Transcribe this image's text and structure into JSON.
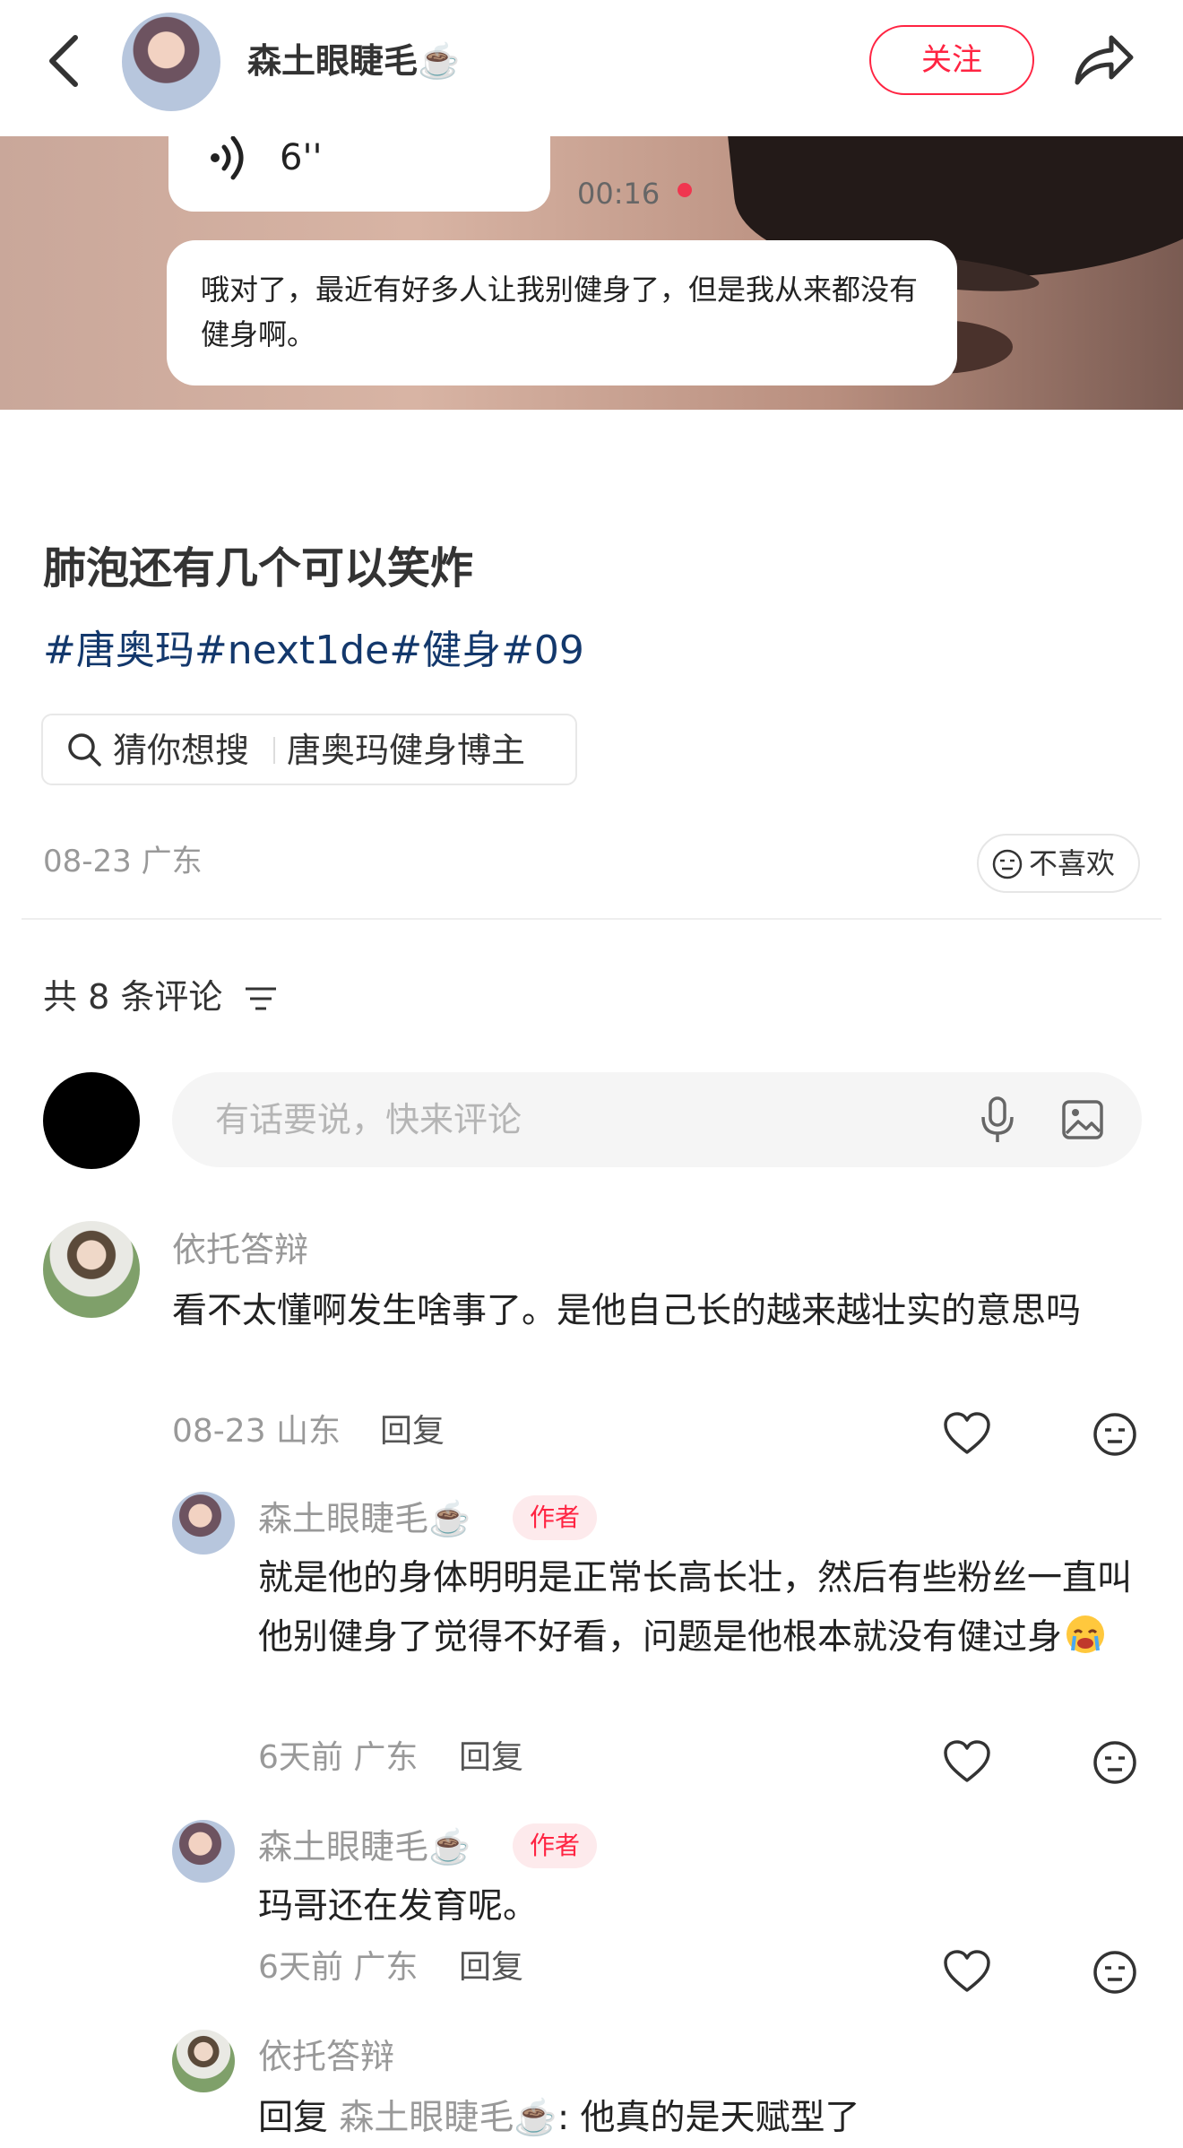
{
  "header": {
    "author_name": "森土眼睫毛☕️",
    "follow_label": "关注"
  },
  "hero": {
    "voice_duration": "6''",
    "time_stamp": "00:16",
    "bubble_text": "哦对了，最近有好多人让我别健身了，但是我从来都没有健身啊。"
  },
  "post": {
    "title": "肺泡还有几个可以笑炸",
    "tags": "#唐奥玛#next1de#健身#09",
    "search_chip_label": "猜你想搜",
    "search_chip_term": "唐奥玛健身博主",
    "meta": "08-23 广东",
    "dislike_label": "不喜欢"
  },
  "comments": {
    "count_label": "共 8 条评论",
    "input_placeholder": "有话要说，快来评论",
    "reply_label": "回复",
    "author_badge": "作者",
    "items": [
      {
        "user": "依托答辩",
        "text": "看不太懂啊发生啥事了。是他自己长的越来越壮实的意思吗",
        "meta": "08-23 山东"
      },
      {
        "user": "森土眼睫毛☕️",
        "text": "就是他的身体明明是正常长高长壮，然后有些粉丝一直叫他别健身了觉得不好看，问题是他根本就没有健过身",
        "meta": "6天前 广东"
      },
      {
        "user": "森土眼睫毛☕️",
        "text": "玛哥还在发育呢。",
        "meta": "6天前 广东"
      },
      {
        "user": "依托答辩",
        "reply_prefix": "回复",
        "mention": "森土眼睫毛☕️",
        "text": ": 他真的是天赋型了"
      }
    ]
  },
  "colors": {
    "accent": "#ff2442",
    "tag": "#13386c",
    "muted": "#999999"
  }
}
